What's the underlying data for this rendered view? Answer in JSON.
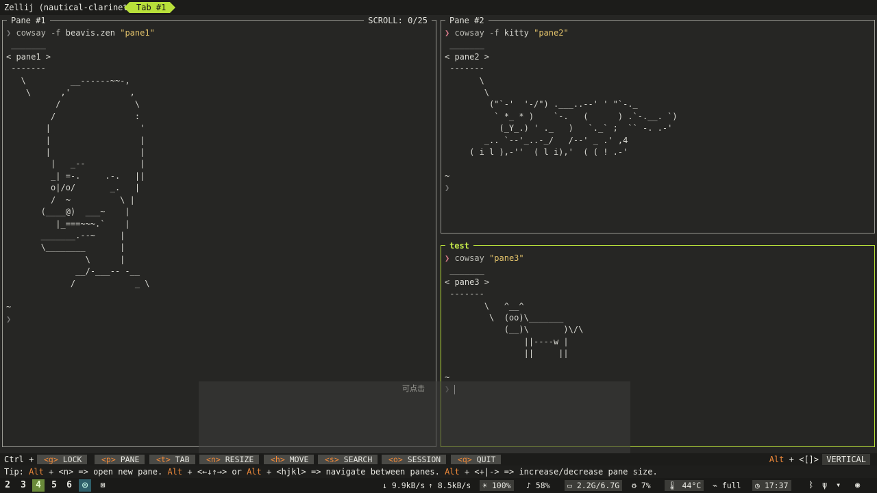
{
  "app": {
    "title": "Zellij (nautical-clarinet)",
    "tab_label": "Tab #1"
  },
  "panes": {
    "pane1": {
      "title": "Pane #1",
      "scroll": "SCROLL:  0/25",
      "prompt": "❯",
      "cmd": "cowsay",
      "flag": "-f",
      "arg": "beavis.zen",
      "str": "\"pane1\"",
      "output": " _______\n< pane1 >\n -------\n   \\         __------~~-,\n    \\      ,'            ,\n          /               \\\n         /                :\n        |                  '\n        |                  |\n        |                  |\n         |   _--           |\n         _| =-.     .-.   ||\n         o|/o/       _.   |\n         /  ~          \\ |\n       (____@)  ___~    |\n          |_===~~~.`    |\n       _______.--~     |\n       \\________       |\n                \\      |\n              __/-___-- -__\n             /            _ \\\n\n~",
      "final_prompt": "❯"
    },
    "pane2": {
      "title": "Pane #2",
      "prompt": "❯",
      "cmd": "cowsay",
      "flag": "-f",
      "arg": "kitty",
      "str": "\"pane2\"",
      "output": " _______\n< pane2 >\n -------\n       \\\n        \\\n         (\"`-'  '-/\") .___..--' ' \"`-._\n          ` *_ * )    `-.   (      ) .`-.__. `)\n           (_Y_.) ' ._   )   `._` ;  `` -. .-'\n        _.. `--'_..-_/   /--' _ .' ,4\n     ( i l ),-''  ( l i),'  ( ( ! .-'\n\n~",
      "final_prompt": "❯"
    },
    "pane3": {
      "title": "test",
      "prompt": "❯",
      "cmd": "cowsay",
      "str": "\"pane3\"",
      "output": " _______\n< pane3 >\n -------\n        \\   ^__^\n         \\  (oo)\\_______\n            (__)\\       )\\/\\\n                ||----w |\n                ||     ||\n\n~",
      "final_prompt": "❯"
    }
  },
  "overlay_label": "可点击",
  "keybar": {
    "modifier": "Ctrl +",
    "items": [
      {
        "key": "<g>",
        "label": "LOCK"
      },
      {
        "key": "<p>",
        "label": "PANE"
      },
      {
        "key": "<t>",
        "label": "TAB"
      },
      {
        "key": "<n>",
        "label": "RESIZE"
      },
      {
        "key": "<h>",
        "label": "MOVE"
      },
      {
        "key": "<s>",
        "label": "SEARCH"
      },
      {
        "key": "<o>",
        "label": "SESSION"
      },
      {
        "key": "<q>",
        "label": "QUIT"
      }
    ],
    "right_mod": "Alt",
    "right_plus": "+",
    "right_key": "<[]>",
    "layout": "VERTICAL"
  },
  "tip": {
    "prefix": "Tip:",
    "alt1": "Alt",
    "part1": " + <n> => open new pane. ",
    "alt2": "Alt",
    "part2": " + <←↓↑→> or ",
    "alt3": "Alt",
    "part3": " + <hjkl> => navigate between panes. ",
    "alt4": "Alt",
    "part4": " + <+|-> => increase/decrease pane size."
  },
  "status": {
    "workspaces": [
      "2",
      "3",
      "4",
      "5",
      "6"
    ],
    "download": "9.9kB/s",
    "upload": "8.5kB/s",
    "brightness": "100%",
    "volume": "58%",
    "memory": "2.2G/6.7G",
    "cpu": "7%",
    "temp": "44°C",
    "battery": "full",
    "clock": "17:37"
  }
}
